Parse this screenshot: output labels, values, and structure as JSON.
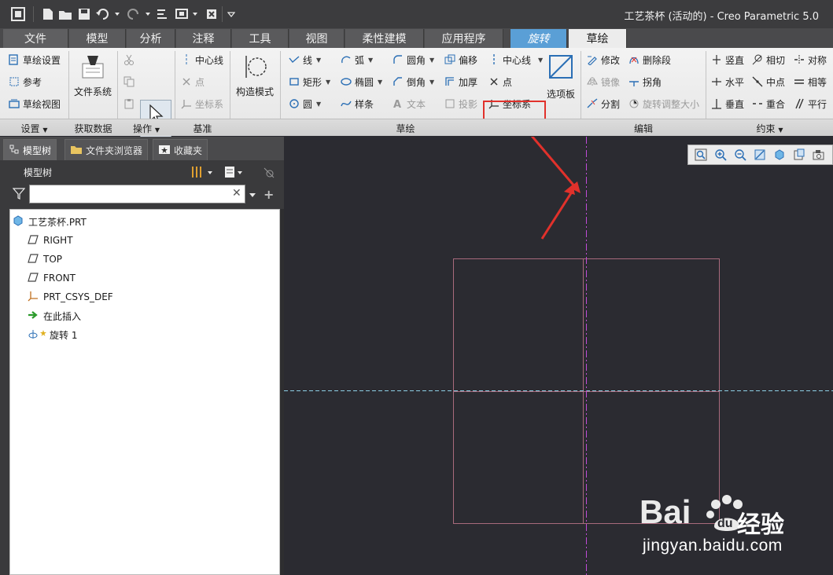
{
  "window": {
    "title": "工艺茶杯 (活动的) - Creo Parametric 5.0"
  },
  "tabs": [
    {
      "label": "文件"
    },
    {
      "label": "模型"
    },
    {
      "label": "分析"
    },
    {
      "label": "注释"
    },
    {
      "label": "工具"
    },
    {
      "label": "视图"
    },
    {
      "label": "柔性建模"
    },
    {
      "label": "应用程序"
    },
    {
      "label": "旋转"
    },
    {
      "label": "草绘"
    }
  ],
  "ribbon": {
    "setup": {
      "sketch_setup": "草绘设置",
      "reference": "参考",
      "sketch_view": "草绘视图",
      "group": "设置"
    },
    "get_data": {
      "file_system": "文件系统",
      "group": "获取数据"
    },
    "operations": {
      "select": "选择",
      "group": "操作"
    },
    "datum": {
      "centerline": "中心线",
      "point": "点",
      "coordinate_system": "坐标系",
      "group": "基准"
    },
    "construction": {
      "mode": "构造模式"
    },
    "sketching": {
      "line": "线",
      "rectangle": "矩形",
      "circle": "圆",
      "arc": "弧",
      "ellipse": "椭圆",
      "spline": "样条",
      "fillet": "圆角",
      "chamfer": "倒角",
      "text": "文本",
      "offset": "偏移",
      "thicken": "加厚",
      "project": "投影",
      "centerline": "中心线",
      "point": "点",
      "coordinate_system": "坐标系",
      "palette": "选项板",
      "group": "草绘"
    },
    "editing": {
      "modify": "修改",
      "delete_segment": "删除段",
      "mirror": "镜像",
      "corner": "拐角",
      "divide": "分割",
      "rotate_resize": "旋转调整大小",
      "group": "编辑"
    },
    "constraints": {
      "vertical": "竖直",
      "tangent": "相切",
      "symmetric": "对称",
      "horizontal": "水平",
      "midpoint": "中点",
      "equal": "相等",
      "perpendicular": "垂直",
      "coincident": "重合",
      "parallel": "平行",
      "group": "约束"
    }
  },
  "left_panel": {
    "tabs": [
      {
        "label": "模型树"
      },
      {
        "label": "文件夹浏览器"
      },
      {
        "label": "收藏夹"
      }
    ],
    "title": "模型树",
    "filter_value": "",
    "tree": [
      {
        "label": "工艺茶杯.PRT",
        "icon": "part-icon"
      },
      {
        "label": "RIGHT",
        "icon": "datum-plane-icon"
      },
      {
        "label": "TOP",
        "icon": "datum-plane-icon"
      },
      {
        "label": "FRONT",
        "icon": "datum-plane-icon"
      },
      {
        "label": "PRT_CSYS_DEF",
        "icon": "csys-icon"
      },
      {
        "label": "在此插入",
        "icon": "insert-arrow-icon"
      },
      {
        "label": "旋转 1",
        "icon": "revolve-icon"
      }
    ]
  },
  "watermark": {
    "brand": "Bai 经验",
    "cn": "经验",
    "url": "jingyan.baidu.com"
  },
  "colors": {
    "canvas": "#2b2b31",
    "sketch_lines": "#a86a7c",
    "vertical_centerline": "#c04bd8",
    "horizontal_centerline": "#8fd0e6",
    "highlight": "#e1312b",
    "active_tab": "#5a9fd6"
  }
}
